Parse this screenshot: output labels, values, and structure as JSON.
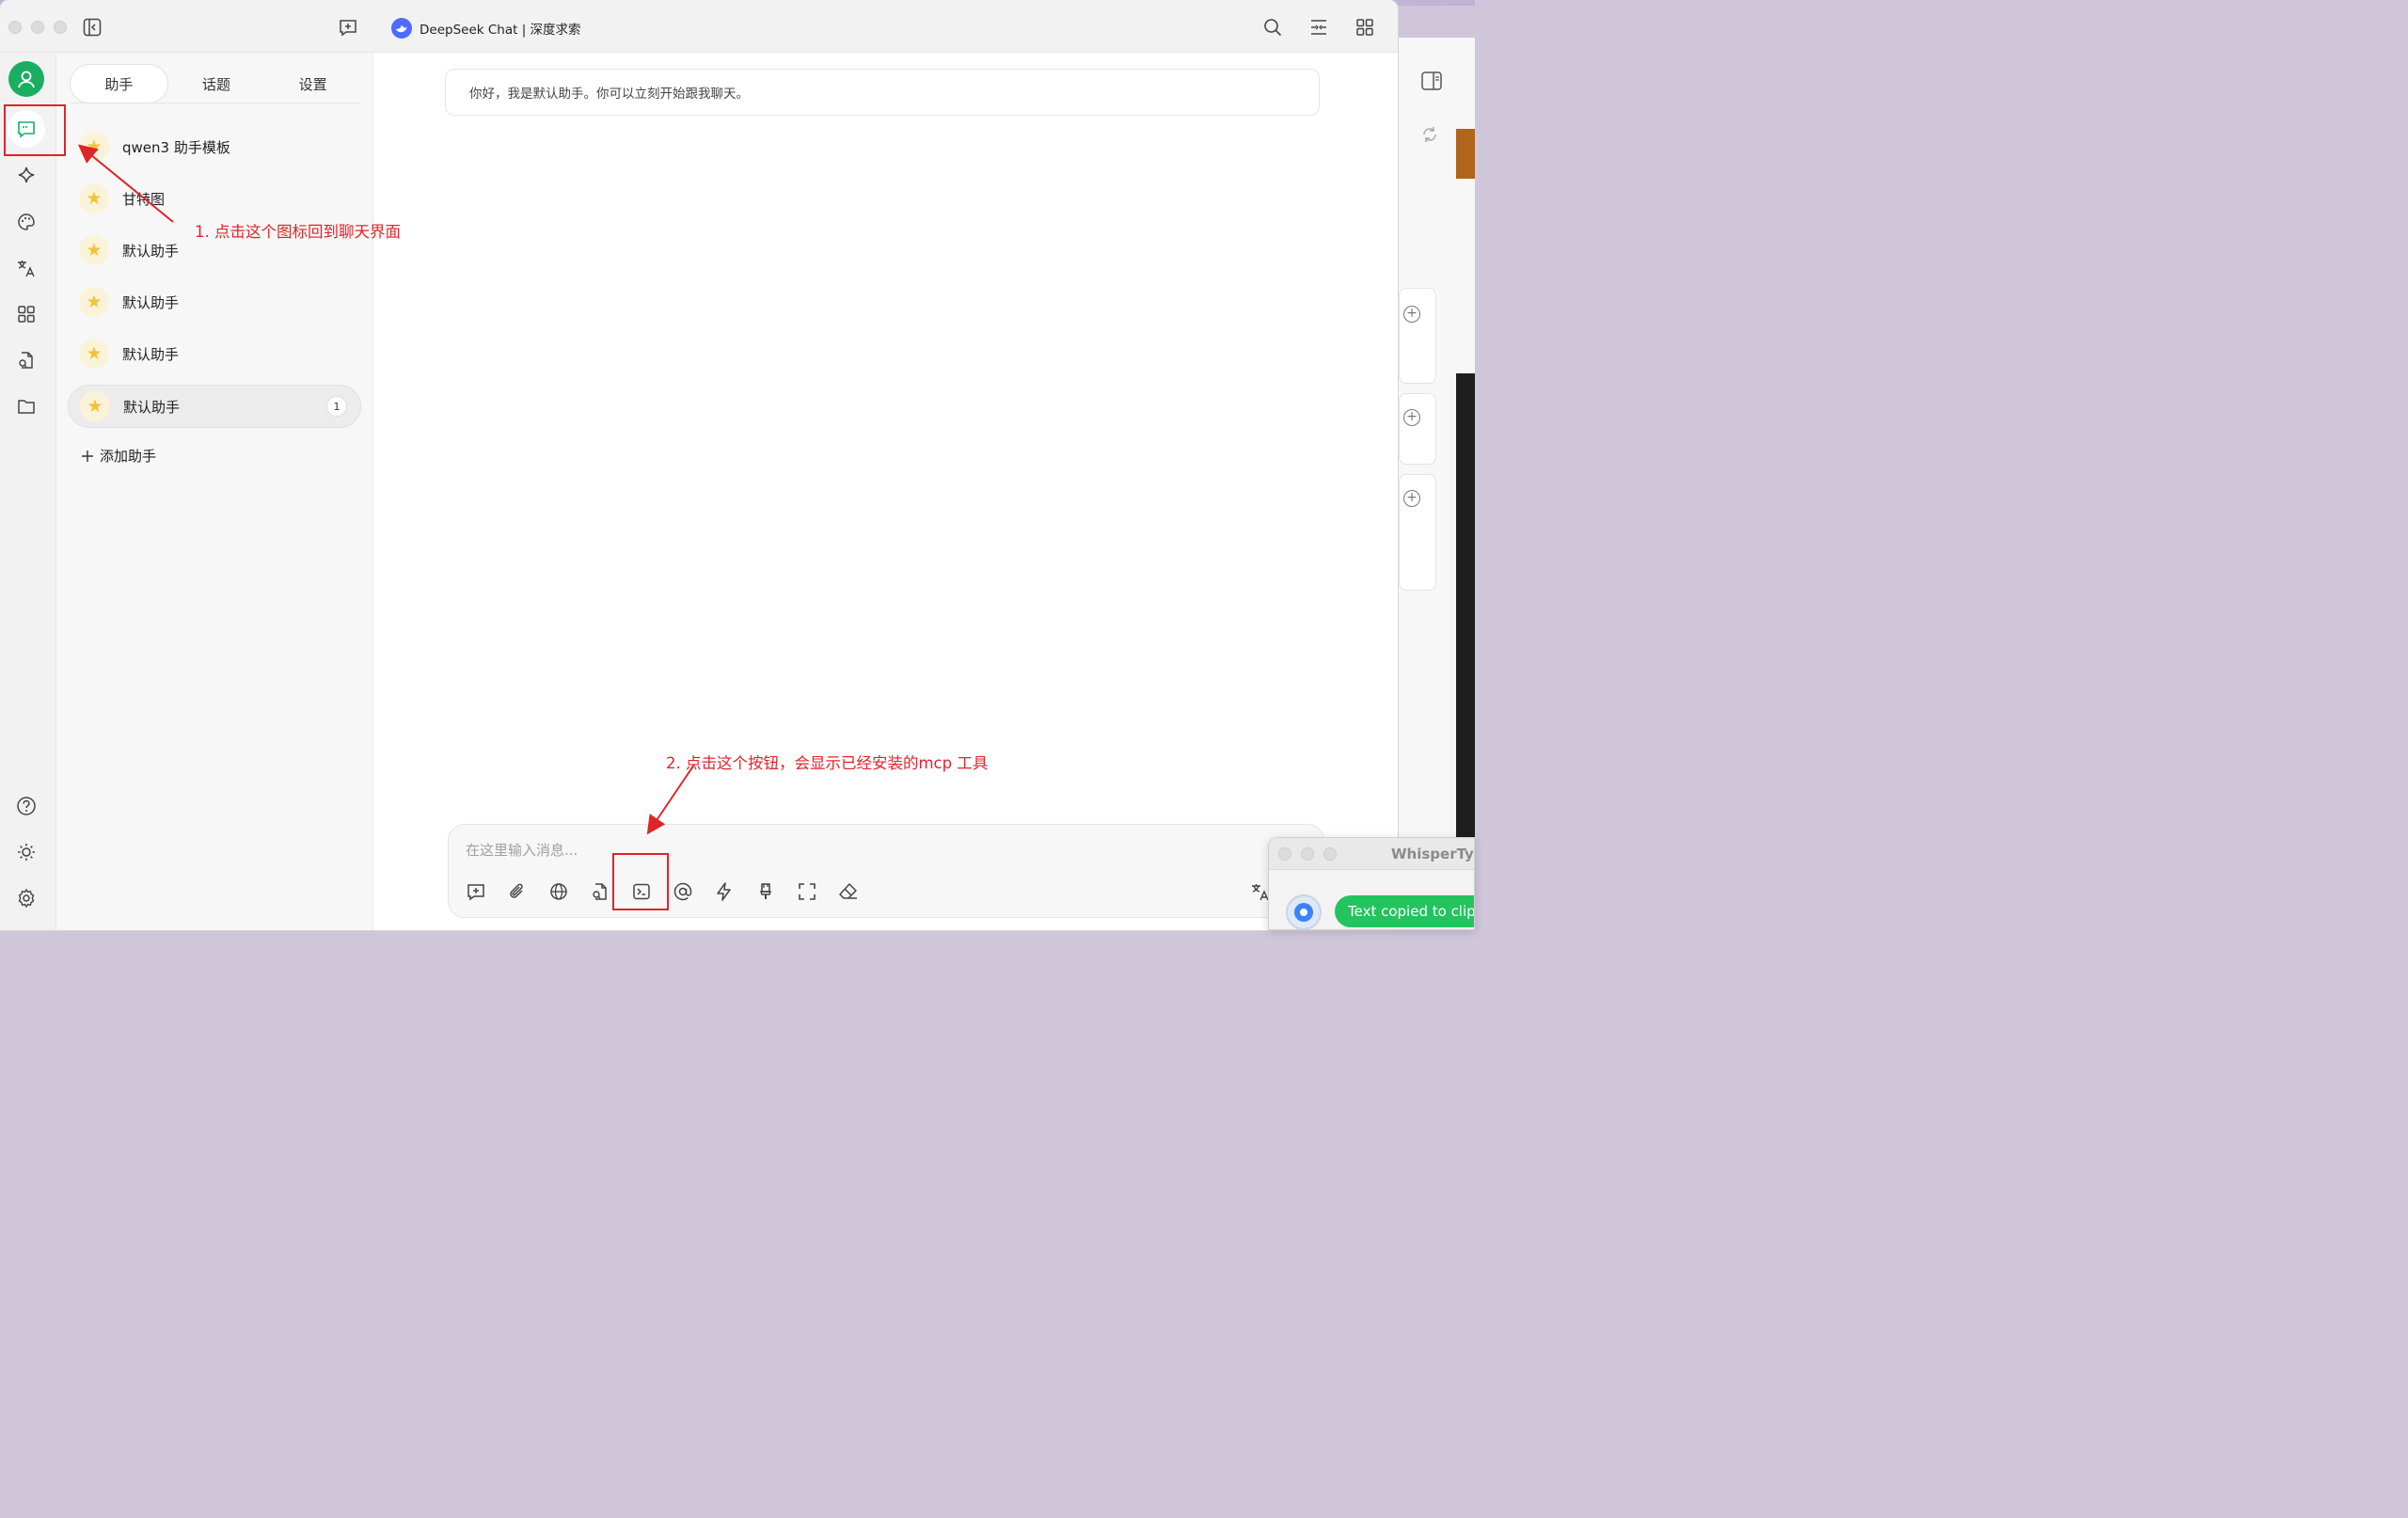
{
  "window": {
    "title": "DeepSeek Chat | 深度求索"
  },
  "icons": {
    "sidebar_toggle": "sidebar-toggle-icon",
    "new_topic": "new-topic-icon",
    "search": "search-icon",
    "minimize_view": "collapse-view-icon",
    "grid": "grid-icon"
  },
  "rail": {
    "items": [
      {
        "name": "user-avatar",
        "icon": "user-icon"
      },
      {
        "name": "chat",
        "icon": "chat-icon",
        "active": true
      },
      {
        "name": "agents",
        "icon": "sparkle-icon"
      },
      {
        "name": "paint",
        "icon": "palette-icon"
      },
      {
        "name": "translate",
        "icon": "translate-icon"
      },
      {
        "name": "apps",
        "icon": "apps-icon"
      },
      {
        "name": "knowledge",
        "icon": "doc-search-icon"
      },
      {
        "name": "files",
        "icon": "folder-icon"
      },
      {
        "name": "help",
        "icon": "help-icon"
      },
      {
        "name": "theme",
        "icon": "theme-icon"
      },
      {
        "name": "settings",
        "icon": "gear-icon"
      }
    ]
  },
  "panel": {
    "tabs": [
      {
        "label": "助手",
        "active": true
      },
      {
        "label": "话题",
        "active": false
      },
      {
        "label": "设置",
        "active": false
      }
    ],
    "assistants": [
      {
        "name": "qwen3 助手模板"
      },
      {
        "name": "甘特图"
      },
      {
        "name": "默认助手"
      },
      {
        "name": "默认助手"
      },
      {
        "name": "默认助手"
      },
      {
        "name": "默认助手",
        "active": true,
        "badge": "1"
      }
    ],
    "add_label": "添加助手"
  },
  "chat": {
    "greeting": "你好，我是默认助手。你可以立刻开始跟我聊天。",
    "input_placeholder": "在这里输入消息...",
    "tools": [
      "new-topic-icon",
      "attachment-icon",
      "web-search-icon",
      "knowledge-icon",
      "mcp-terminal-icon",
      "mention-icon",
      "quick-phrase-icon",
      "clear-context-icon",
      "expand-icon",
      "eraser-icon",
      "translate-icon"
    ]
  },
  "whisper": {
    "title": "WhisperTyp",
    "status": "Text copied to clip"
  },
  "annotations": {
    "step1": "1. 点击这个图标回到聊天界面",
    "step2": "2. 点击这个按钮，会显示已经安装的mcp 工具",
    "color": "#e0242b"
  },
  "colors": {
    "accent": "#1aae63",
    "brand": "#4d6bfe",
    "success_pill": "#23c45e"
  }
}
